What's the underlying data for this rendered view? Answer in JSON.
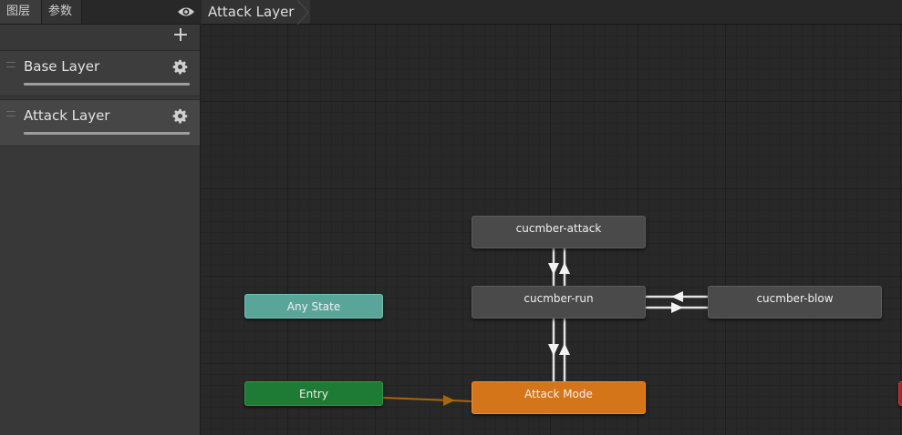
{
  "tabs": [
    {
      "label": "图层"
    },
    {
      "label": "参数"
    }
  ],
  "icons": {
    "visibility": "eye-icon",
    "add": "plus-icon",
    "settings": "gear-icon",
    "drag": "drag-handle-icon"
  },
  "sidebar": {
    "add_label": "+",
    "layers": [
      {
        "name": "Base Layer",
        "weight": 1.0
      },
      {
        "name": "Attack Layer",
        "weight": 1.0,
        "selected": true
      }
    ]
  },
  "breadcrumb": {
    "label": "Attack Layer"
  },
  "states": {
    "attack": "cucmber-attack",
    "run": "cucmber-run",
    "blow": "cucmber-blow",
    "any": "Any State",
    "entry": "Entry",
    "default": "Attack Mode"
  },
  "colors": {
    "any_state": "#5aa59a",
    "entry": "#1e7b35",
    "default_state": "#d47519",
    "state": "#4a4a4a",
    "entry_transition": "#a8660c",
    "transition": "#e0e0e0",
    "exit_state": "#b02424"
  }
}
